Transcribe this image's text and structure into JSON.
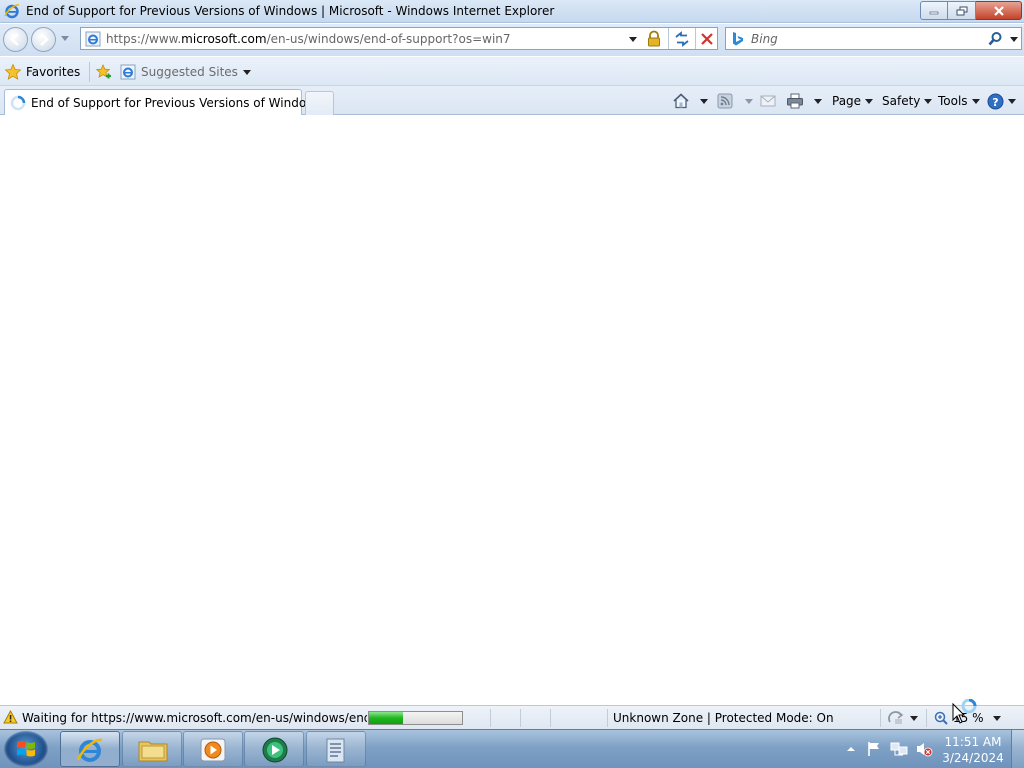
{
  "window": {
    "title": "End of Support for Previous Versions of Windows | Microsoft - Windows Internet Explorer"
  },
  "address": {
    "url_prefix": "https://www.",
    "url_domain": "microsoft.com",
    "url_path": "/en-us/windows/end-of-support?os=win7"
  },
  "search": {
    "placeholder": "Bing"
  },
  "favorites": {
    "favorites_label": "Favorites",
    "suggested_sites_label": "Suggested Sites"
  },
  "tab": {
    "title": "End of Support for Previous Versions of Windows..."
  },
  "commandbar": {
    "page_label": "Page",
    "safety_label": "Safety",
    "tools_label": "Tools"
  },
  "status": {
    "text": "Waiting for https://www.microsoft.com/en-us/windows/end-of-",
    "progress_fraction": 0.37,
    "zone": "Unknown Zone | Protected Mode: On",
    "zoom": "15 %"
  },
  "taskbar": {
    "time": "11:51 AM",
    "date": "3/24/2024"
  },
  "colors": {
    "progress": "#21b521",
    "accent": "#1c5fb6",
    "close_button": "#c4432b"
  }
}
